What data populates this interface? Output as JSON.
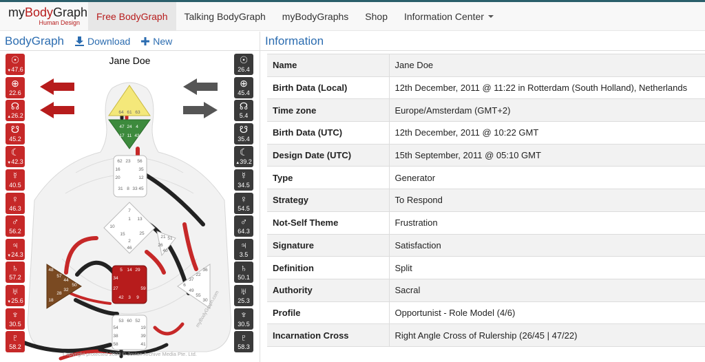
{
  "brand": {
    "main_prefix": "my",
    "main_highlight": "Body",
    "main_suffix": "Graph",
    "sub": "Human Design"
  },
  "nav": {
    "items": [
      {
        "label": "Free BodyGraph",
        "active": true
      },
      {
        "label": "Talking BodyGraph"
      },
      {
        "label": "myBodyGraphs"
      },
      {
        "label": "Shop"
      },
      {
        "label": "Information Center",
        "dropdown": true
      }
    ]
  },
  "left_panel": {
    "title": "BodyGraph",
    "download_label": "Download",
    "new_label": "New",
    "chart_name": "Jane Doe",
    "copyright": "Copyright protected 2023 © Jovian Archive Media Pte. Ltd.",
    "watermark": "myBodyGraph.com"
  },
  "design_planets": [
    {
      "glyph": "☉",
      "value": "47.6",
      "mark": "▼",
      "icon": "sun-icon"
    },
    {
      "glyph": "⊕",
      "value": "22.6",
      "mark": "",
      "icon": "earth-icon"
    },
    {
      "glyph": "☊",
      "value": "26.2",
      "mark": "▲",
      "icon": "north-node-icon"
    },
    {
      "glyph": "☋",
      "value": "45.2",
      "mark": "",
      "icon": "south-node-icon"
    },
    {
      "glyph": "☾",
      "value": "42.3",
      "mark": "▼",
      "icon": "moon-icon"
    },
    {
      "glyph": "☿",
      "value": "40.5",
      "mark": "",
      "icon": "mercury-icon"
    },
    {
      "glyph": "♀",
      "value": "46.3",
      "mark": "",
      "icon": "venus-icon"
    },
    {
      "glyph": "♂",
      "value": "56.2",
      "mark": "",
      "icon": "mars-icon"
    },
    {
      "glyph": "♃",
      "value": "24.3",
      "mark": "▼",
      "icon": "jupiter-icon"
    },
    {
      "glyph": "♄",
      "value": "57.2",
      "mark": "",
      "icon": "saturn-icon"
    },
    {
      "glyph": "♅",
      "value": "25.6",
      "mark": "▼",
      "icon": "uranus-icon"
    },
    {
      "glyph": "♆",
      "value": "30.5",
      "mark": "",
      "icon": "neptune-icon"
    },
    {
      "glyph": "♇",
      "value": "58.2",
      "mark": "",
      "icon": "pluto-icon"
    }
  ],
  "personality_planets": [
    {
      "glyph": "☉",
      "value": "26.4",
      "mark": "",
      "icon": "sun-icon"
    },
    {
      "glyph": "⊕",
      "value": "45.4",
      "mark": "",
      "icon": "earth-icon"
    },
    {
      "glyph": "☊",
      "value": "5.4",
      "mark": "",
      "icon": "north-node-icon"
    },
    {
      "glyph": "☋",
      "value": "35.4",
      "mark": "",
      "icon": "south-node-icon"
    },
    {
      "glyph": "☾",
      "value": "39.2",
      "mark": "▲",
      "icon": "moon-icon"
    },
    {
      "glyph": "☿",
      "value": "34.5",
      "mark": "",
      "icon": "mercury-icon"
    },
    {
      "glyph": "♀",
      "value": "54.5",
      "mark": "",
      "icon": "venus-icon"
    },
    {
      "glyph": "♂",
      "value": "64.3",
      "mark": "",
      "icon": "mars-icon"
    },
    {
      "glyph": "♃",
      "value": "3.5",
      "mark": "",
      "icon": "jupiter-icon"
    },
    {
      "glyph": "♄",
      "value": "50.1",
      "mark": "",
      "icon": "saturn-icon"
    },
    {
      "glyph": "♅",
      "value": "25.3",
      "mark": "",
      "icon": "uranus-icon"
    },
    {
      "glyph": "♆",
      "value": "30.5",
      "mark": "",
      "icon": "neptune-icon"
    },
    {
      "glyph": "♇",
      "value": "58.3",
      "mark": "",
      "icon": "pluto-icon"
    }
  ],
  "info": {
    "title": "Information",
    "rows": [
      {
        "key": "Name",
        "value": "Jane Doe"
      },
      {
        "key": "Birth Data (Local)",
        "value": "12th December, 2011 @ 11:22 in Rotterdam (South Holland), Netherlands"
      },
      {
        "key": "Time zone",
        "value": "Europe/Amsterdam (GMT+2)"
      },
      {
        "key": "Birth Data (UTC)",
        "value": "12th December, 2011 @ 10:22 GMT"
      },
      {
        "key": "Design Date (UTC)",
        "value": "15th September, 2011 @ 05:10 GMT"
      },
      {
        "key": "Type",
        "value": "Generator"
      },
      {
        "key": "Strategy",
        "value": "To Respond"
      },
      {
        "key": "Not-Self Theme",
        "value": "Frustration"
      },
      {
        "key": "Signature",
        "value": "Satisfaction"
      },
      {
        "key": "Definition",
        "value": "Split"
      },
      {
        "key": "Authority",
        "value": "Sacral"
      },
      {
        "key": "Profile",
        "value": "Opportunist - Role Model (4/6)"
      },
      {
        "key": "Incarnation Cross",
        "value": "Right Angle Cross of Rulership (26/45 | 47/22)"
      }
    ]
  },
  "centers": {
    "head_gates": [
      "64",
      "61",
      "63"
    ],
    "ajna_gates": [
      "47",
      "24",
      "4",
      "17",
      "11",
      "43"
    ],
    "throat_gates": [
      "62",
      "23",
      "56",
      "16",
      "35",
      "20",
      "12",
      "31",
      "8",
      "33",
      "45"
    ],
    "g_gates": [
      "7",
      "1",
      "13",
      "10",
      "25",
      "15",
      "2",
      "46"
    ],
    "heart_gates": [
      "21",
      "51",
      "26",
      "40"
    ],
    "spleen_gates": [
      "48",
      "57",
      "44",
      "50",
      "32",
      "28",
      "18"
    ],
    "sacral_gates": [
      "5",
      "14",
      "29",
      "34",
      "27",
      "59",
      "42",
      "3",
      "9"
    ],
    "solar_gates": [
      "36",
      "22",
      "37",
      "6",
      "49",
      "55",
      "30"
    ],
    "root_gates": [
      "53",
      "60",
      "52",
      "54",
      "19",
      "38",
      "39",
      "58",
      "41"
    ]
  },
  "colors": {
    "design": "#c62828",
    "personality": "#3a3a3a",
    "head": "#f4e87a",
    "ajna": "#3d8a3d",
    "sacral": "#b71c1c",
    "spleen": "#7a4a22",
    "link": "#2b6cb0"
  }
}
